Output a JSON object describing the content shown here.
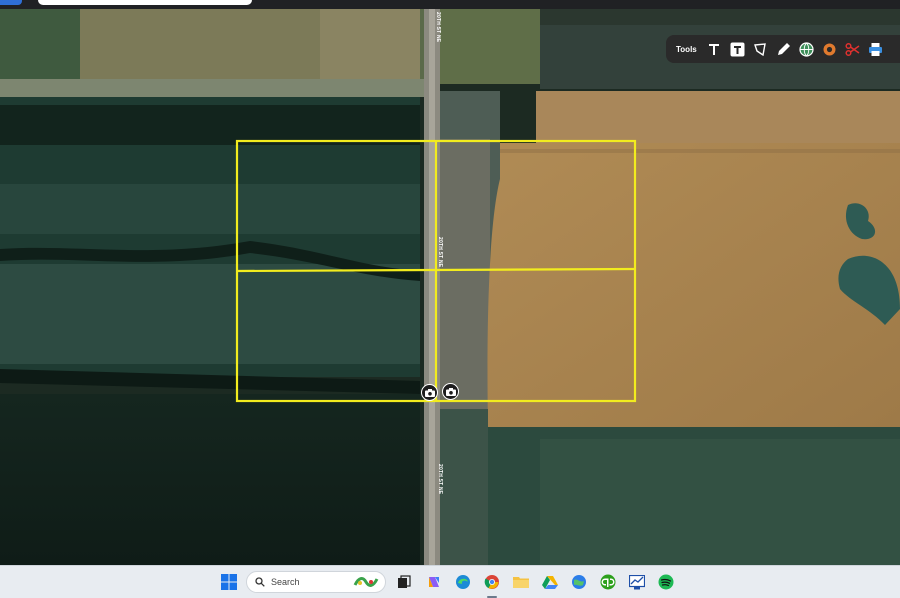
{
  "toolbar": {
    "label": "Tools",
    "items": [
      "text-tool",
      "text-box-tool",
      "polygon-tool",
      "pencil-tool",
      "globe-tool",
      "circle-tool",
      "scissors-tool",
      "print-tool"
    ]
  },
  "map": {
    "road_labels": [
      "20TH ST NE",
      "20TH ST NE",
      "20TH ST NE"
    ],
    "parcel_color": "#f2ec1e"
  },
  "taskbar": {
    "search_placeholder": "Search",
    "apps": [
      "start",
      "search",
      "widgets",
      "task-view",
      "copilot",
      "edge",
      "chrome",
      "file-explorer",
      "google-drive",
      "maps-app",
      "quickbooks",
      "screen-app",
      "spotify"
    ]
  }
}
